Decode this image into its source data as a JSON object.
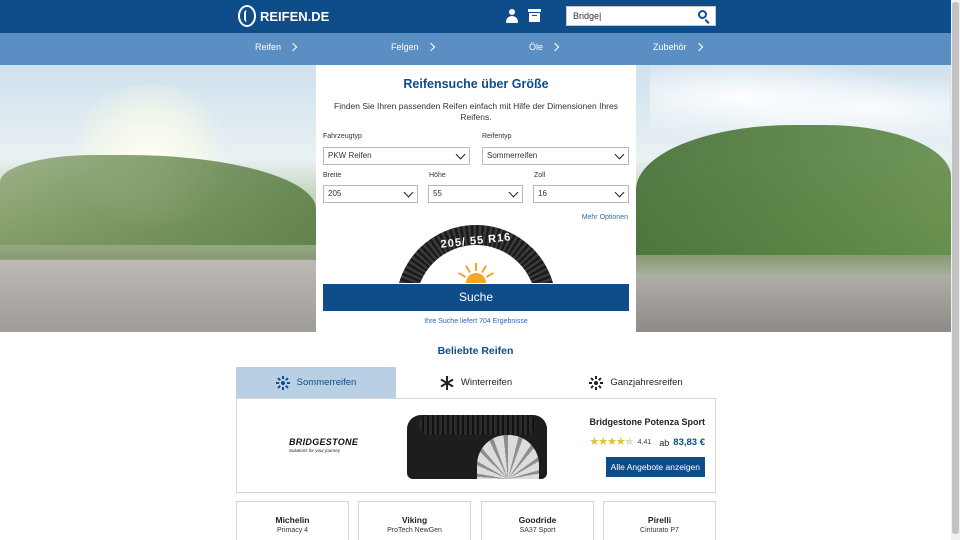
{
  "header": {
    "logo_text": "REIFEN.DE",
    "search": {
      "value": "Bridge|",
      "placeholder": ""
    }
  },
  "nav": {
    "items": [
      {
        "label": "Reifen"
      },
      {
        "label": "Felgen"
      },
      {
        "label": "Öle"
      },
      {
        "label": "Zubehör"
      }
    ]
  },
  "search_card": {
    "title": "Reifensuche über Größe",
    "description": "Finden Sie Ihren passenden Reifen einfach mit Hilfe der Dimensionen Ihres Reifens.",
    "fields": {
      "vehicle_type": {
        "label": "Fahrzeugtyp",
        "value": "PKW Reifen"
      },
      "tire_type": {
        "label": "Reifentyp",
        "value": "Sommerreifen"
      },
      "width": {
        "label": "Breite",
        "value": "205"
      },
      "height": {
        "label": "Höhe",
        "value": "55"
      },
      "rim": {
        "label": "Zoll",
        "value": "16"
      }
    },
    "more_options": "Mehr Optionen",
    "tire_size_text": "205/ 55 R16",
    "search_button": "Suche",
    "result_count": "Ihre Suche liefert 704 Ergebnisse"
  },
  "popular": {
    "title": "Beliebte Reifen",
    "tabs": [
      {
        "label": "Sommerreifen",
        "icon": "sun-icon",
        "active": true
      },
      {
        "label": "Winterreifen",
        "icon": "snowflake-icon",
        "active": false
      },
      {
        "label": "Ganzjahresreifen",
        "icon": "all-season-icon",
        "active": false
      }
    ],
    "featured": {
      "brand_logo_text": "BRIDGESTONE",
      "brand_tagline": "Solutions for your journey",
      "name": "Bridgestone Potenza Sport",
      "rating": "4,41",
      "rating_fraction": 0.882,
      "price_prefix": "ab",
      "price": "83,83 €",
      "offers_button": "Alle Angebote anzeigen"
    },
    "brand_cards": [
      {
        "brand": "Michelin",
        "model": "Primacy 4"
      },
      {
        "brand": "Viking",
        "model": "ProTech NewGen"
      },
      {
        "brand": "Goodride",
        "model": "SA37 Sport"
      },
      {
        "brand": "Pirelli",
        "model": "Cinturato P7"
      }
    ]
  },
  "colors": {
    "primary": "#0e4c8a",
    "nav_bar": "#5b8fc4",
    "active_tab": "#b9cfe3",
    "star": "#e3c234"
  }
}
